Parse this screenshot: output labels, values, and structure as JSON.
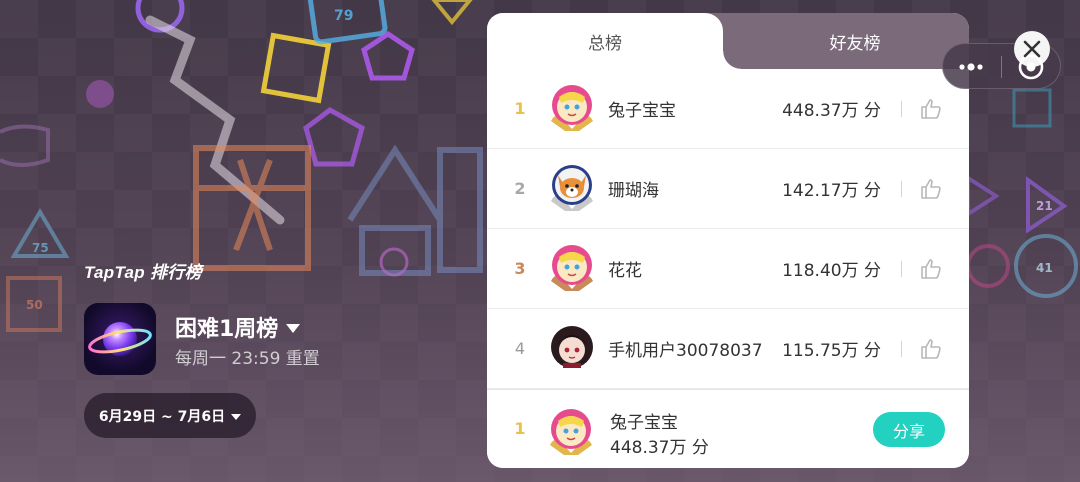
{
  "left": {
    "brand": "TapTap 排行榜",
    "board_title": "困难1周榜",
    "reset": "每周一 23:59 重置",
    "date_range": "6月29日 ~ 7月6日"
  },
  "tabs": [
    {
      "label": "总榜",
      "active": true
    },
    {
      "label": "好友榜",
      "active": false
    }
  ],
  "rows": [
    {
      "rank": "1",
      "name": "兔子宝宝",
      "score": "448.37万 分",
      "avatar": "bunny-avatar",
      "rank_color": "#e8c04a"
    },
    {
      "rank": "2",
      "name": "珊瑚海",
      "score": "142.17万 分",
      "avatar": "shiba-avatar",
      "rank_color": "#a8a8a8"
    },
    {
      "rank": "3",
      "name": "花花",
      "score": "118.40万 分",
      "avatar": "bunny-avatar",
      "rank_color": "#c98a5a"
    },
    {
      "rank": "4",
      "name": "手机用户30078037",
      "score": "115.75万 分",
      "avatar": "anime-girl-avatar",
      "rank_color": "#9a9a9a"
    }
  ],
  "me": {
    "rank": "1",
    "name": "兔子宝宝",
    "score": "448.37万 分",
    "share_label": "分享"
  },
  "background_numbers": [
    "79",
    "75",
    "50",
    "21",
    "41"
  ],
  "colors": {
    "accent": "#22d1c0",
    "gold": "#e8c04a",
    "silver": "#a8a8a8",
    "bronze": "#c98a5a",
    "tab_inactive_bg": "#7a6a7a"
  }
}
